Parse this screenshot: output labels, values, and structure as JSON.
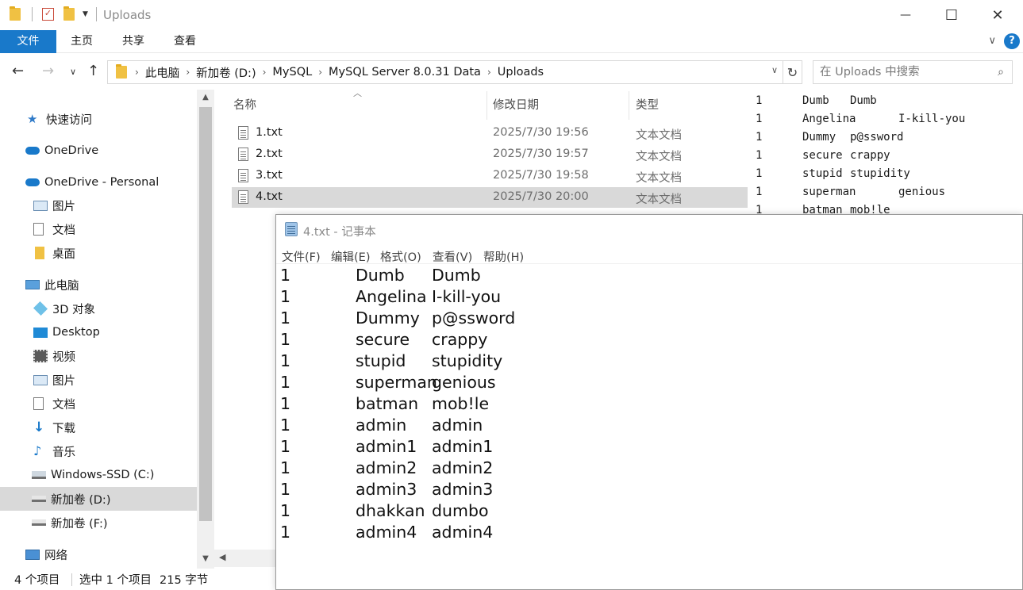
{
  "window": {
    "title": "Uploads",
    "minimize_icon": "minimize-icon",
    "maximize_icon": "maximize-icon",
    "close_icon": "close-icon",
    "close_glyph": "✕",
    "minimize_glyph": "—",
    "maximize_glyph": "☐"
  },
  "ribbon": {
    "tabs": [
      {
        "label": "文件"
      },
      {
        "label": "主页"
      },
      {
        "label": "共享"
      },
      {
        "label": "查看"
      }
    ],
    "help": "?",
    "expand": "∨"
  },
  "address": {
    "crumbs": [
      "此电脑",
      "新加卷 (D:)",
      "MySQL",
      "MySQL Server 8.0.31 Data",
      "Uploads"
    ],
    "search_placeholder": "在 Uploads 中搜索"
  },
  "sidebar": {
    "items": [
      {
        "label": "快速访问",
        "icon": "star-icon"
      },
      {
        "label": "OneDrive",
        "icon": "cloud-icon"
      },
      {
        "label": "OneDrive - Personal",
        "icon": "cloud-icon"
      },
      {
        "label": "图片",
        "icon": "pictures-icon"
      },
      {
        "label": "文档",
        "icon": "documents-icon"
      },
      {
        "label": "桌面",
        "icon": "folder-icon"
      },
      {
        "label": "此电脑",
        "icon": "computer-icon"
      },
      {
        "label": "3D 对象",
        "icon": "cube-icon"
      },
      {
        "label": "Desktop",
        "icon": "desktop-icon"
      },
      {
        "label": "视频",
        "icon": "video-icon"
      },
      {
        "label": "图片",
        "icon": "pictures-icon"
      },
      {
        "label": "文档",
        "icon": "documents-icon"
      },
      {
        "label": "下载",
        "icon": "download-icon"
      },
      {
        "label": "音乐",
        "icon": "music-icon"
      },
      {
        "label": "Windows-SSD (C:)",
        "icon": "drive-icon"
      },
      {
        "label": "新加卷 (D:)",
        "icon": "drive-icon",
        "selected": true
      },
      {
        "label": "新加卷 (F:)",
        "icon": "drive-icon"
      },
      {
        "label": "网络",
        "icon": "network-icon"
      }
    ]
  },
  "filelist": {
    "columns": [
      "名称",
      "修改日期",
      "类型"
    ],
    "files": [
      {
        "name": "1.txt",
        "date": "2025/7/30 19:56",
        "type": "文本文档"
      },
      {
        "name": "2.txt",
        "date": "2025/7/30 19:57",
        "type": "文本文档"
      },
      {
        "name": "3.txt",
        "date": "2025/7/30 19:58",
        "type": "文本文档"
      },
      {
        "name": "4.txt",
        "date": "2025/7/30 20:00",
        "type": "文本文档",
        "selected": true
      }
    ]
  },
  "preview": {
    "rows": [
      [
        "1",
        "Dumb",
        "Dumb"
      ],
      [
        "1",
        "Angelina",
        "I-kill-you"
      ],
      [
        "1",
        "Dummy",
        "p@ssword"
      ],
      [
        "1",
        "secure",
        "crappy"
      ],
      [
        "1",
        "stupid",
        "stupidity"
      ],
      [
        "1",
        "superman",
        "genious"
      ],
      [
        "1",
        "batman",
        "mob!le"
      ]
    ]
  },
  "status": {
    "count": "4 个项目",
    "selection": "选中 1 个项目",
    "size": "215 字节"
  },
  "notepad": {
    "title": "4.txt - 记事本",
    "menu": [
      "文件(F)",
      "编辑(E)",
      "格式(O)",
      "查看(V)",
      "帮助(H)"
    ],
    "rows": [
      [
        "1",
        "Dumb",
        "Dumb"
      ],
      [
        "1",
        "Angelina",
        "I-kill-you"
      ],
      [
        "1",
        "Dummy",
        "p@ssword"
      ],
      [
        "1",
        "secure",
        "crappy"
      ],
      [
        "1",
        "stupid",
        "stupidity"
      ],
      [
        "1",
        "superman",
        "genious"
      ],
      [
        "1",
        "batman",
        "mob!le"
      ],
      [
        "1",
        "admin",
        "admin"
      ],
      [
        "1",
        "admin1",
        "admin1"
      ],
      [
        "1",
        "admin2",
        "admin2"
      ],
      [
        "1",
        "admin3",
        "admin3"
      ],
      [
        "1",
        "dhakkan",
        "dumbo"
      ],
      [
        "1",
        "admin4",
        "admin4"
      ]
    ]
  },
  "colors": {
    "accent": "#1979ca",
    "selected_bg": "#d9d9d9"
  }
}
